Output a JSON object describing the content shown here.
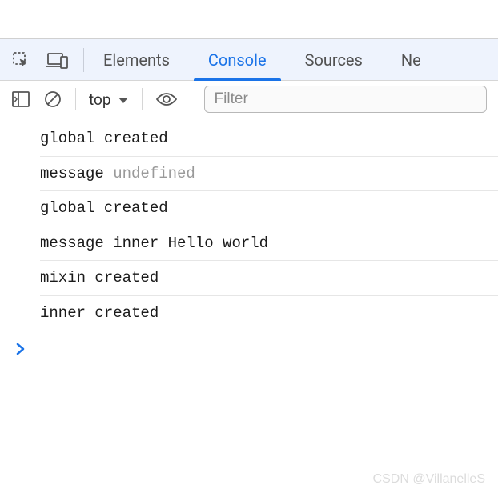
{
  "tabs": {
    "elements": "Elements",
    "console": "Console",
    "sources": "Sources",
    "network": "Ne"
  },
  "toolbar": {
    "context": "top",
    "filter_placeholder": "Filter"
  },
  "logs": [
    {
      "parts": [
        {
          "text": "global created",
          "cls": ""
        }
      ]
    },
    {
      "parts": [
        {
          "text": "message ",
          "cls": ""
        },
        {
          "text": "undefined",
          "cls": "log-undefined"
        }
      ]
    },
    {
      "parts": [
        {
          "text": "global created",
          "cls": ""
        }
      ]
    },
    {
      "parts": [
        {
          "text": "message inner Hello world",
          "cls": ""
        }
      ]
    },
    {
      "parts": [
        {
          "text": "mixin created",
          "cls": ""
        }
      ]
    },
    {
      "parts": [
        {
          "text": "inner created",
          "cls": ""
        }
      ]
    }
  ],
  "watermark": "CSDN @VillanelleS"
}
